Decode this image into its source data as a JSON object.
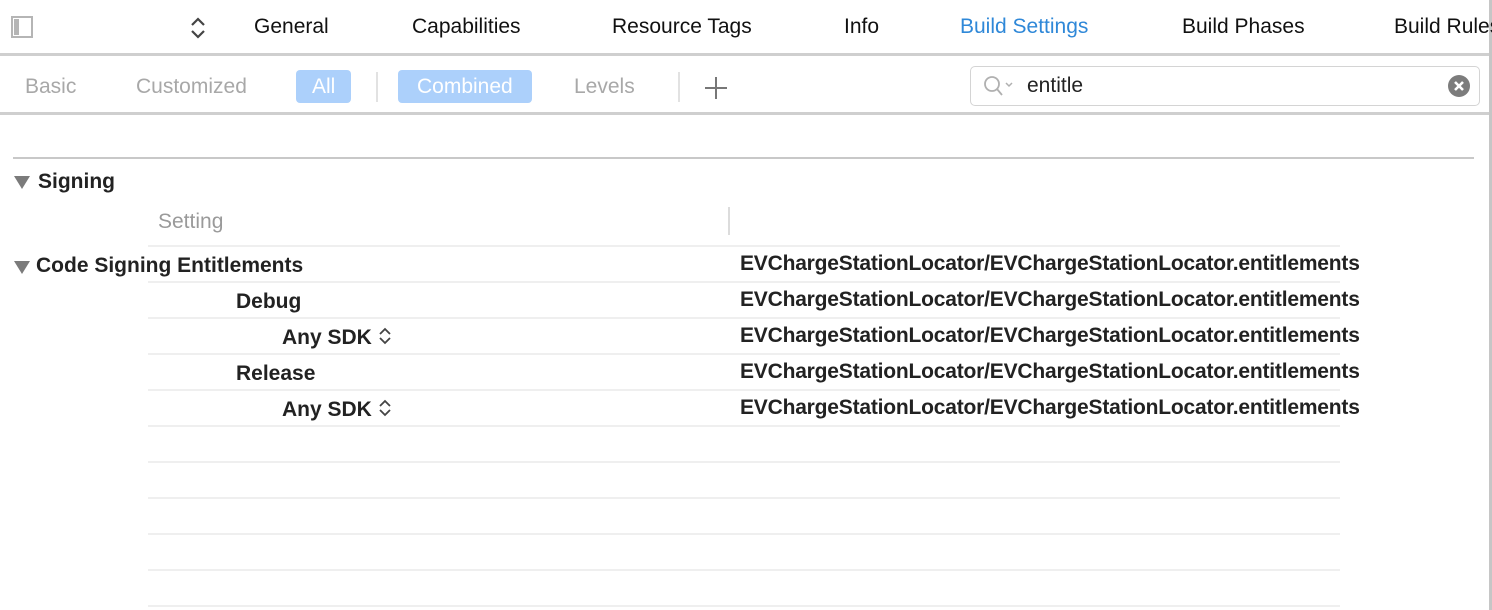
{
  "tabs": {
    "items": [
      {
        "label": "General",
        "active": false
      },
      {
        "label": "Capabilities",
        "active": false
      },
      {
        "label": "Resource Tags",
        "active": false
      },
      {
        "label": "Info",
        "active": false
      },
      {
        "label": "Build Settings",
        "active": true
      },
      {
        "label": "Build Phases",
        "active": false
      },
      {
        "label": "Build Rules",
        "active": false
      }
    ],
    "active_color": "#2f88d8"
  },
  "filters": {
    "scope": [
      {
        "label": "Basic",
        "selected": false
      },
      {
        "label": "Customized",
        "selected": false
      },
      {
        "label": "All",
        "selected": true
      }
    ],
    "view": [
      {
        "label": "Combined",
        "selected": true
      },
      {
        "label": "Levels",
        "selected": false
      }
    ],
    "add_icon": "plus-icon",
    "selected_color": "#acd0fb"
  },
  "search": {
    "value": "entitle",
    "icon": "search-icon",
    "clear_icon": "clear-icon"
  },
  "section": {
    "title": "Signing",
    "column_header": "Setting",
    "rows": [
      {
        "label": "Code Signing Entitlements",
        "value": "EVChargeStationLocator/EVChargeStationLocator.entitlements",
        "level": 0,
        "disclosure": true
      },
      {
        "label": "Debug",
        "value": "EVChargeStationLocator/EVChargeStationLocator.entitlements",
        "level": 1
      },
      {
        "label": "Any SDK",
        "value": "EVChargeStationLocator/EVChargeStationLocator.entitlements",
        "level": 2,
        "stepper": true
      },
      {
        "label": "Release",
        "value": "EVChargeStationLocator/EVChargeStationLocator.entitlements",
        "level": 1
      },
      {
        "label": "Any SDK",
        "value": "EVChargeStationLocator/EVChargeStationLocator.entitlements",
        "level": 2,
        "stepper": true
      }
    ]
  }
}
